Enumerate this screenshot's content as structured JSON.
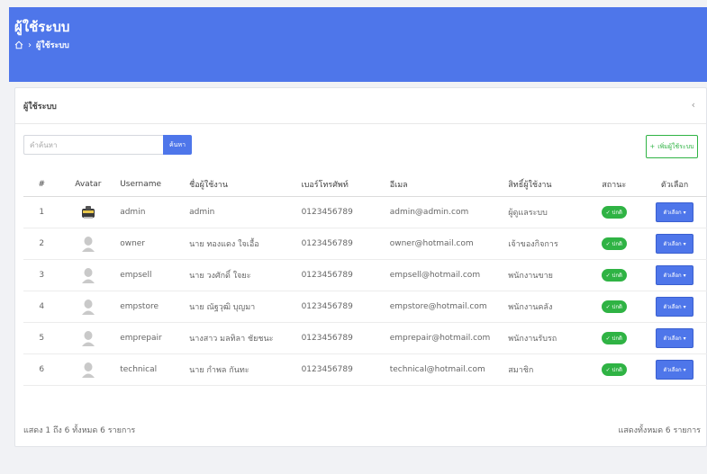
{
  "header": {
    "title": "ผู้ใช้ระบบ",
    "breadcrumb_current": "ผู้ใช้ระบบ",
    "breadcrumb_sep": "›"
  },
  "card": {
    "title": "ผู้ใช้ระบบ",
    "collapse_icon": "‹"
  },
  "search": {
    "placeholder": "คำค้นหา",
    "button_label": "ค้นหา"
  },
  "add_user": {
    "icon": "+",
    "label": "เพิ่มผู้ใช้ระบบ"
  },
  "table": {
    "headers": {
      "num": "#",
      "avatar": "Avatar",
      "username": "Username",
      "name": "ชื่อผู้ใช้งาน",
      "phone": "เบอร์โทรศัพท์",
      "email": "อีเมล",
      "role": "สิทธิ์ผู้ใช้งาน",
      "status": "สถานะ",
      "action": "ตัวเลือก"
    },
    "rows": [
      {
        "num": "1",
        "avatar": "robot-avatar",
        "username": "admin",
        "name": "admin",
        "phone": "0123456789",
        "email": "admin@admin.com",
        "role": "ผู้ดูแลระบบ",
        "status": "✓ ปกติ",
        "action": "ตัวเลือก ▾"
      },
      {
        "num": "2",
        "avatar": "user-avatar",
        "username": "owner",
        "name": "นาย ทองแดง ใจเอื้อ",
        "phone": "0123456789",
        "email": "owner@hotmail.com",
        "role": "เจ้าของกิจการ",
        "status": "✓ ปกติ",
        "action": "ตัวเลือก ▾"
      },
      {
        "num": "3",
        "avatar": "user-avatar",
        "username": "empsell",
        "name": "นาย วงศักดิ์ ใจยะ",
        "phone": "0123456789",
        "email": "empsell@hotmail.com",
        "role": "พนักงานขาย",
        "status": "✓ ปกติ",
        "action": "ตัวเลือก ▾"
      },
      {
        "num": "4",
        "avatar": "user-avatar",
        "username": "empstore",
        "name": "นาย ณัฐวุฒิ บุญมา",
        "phone": "0123456789",
        "email": "empstore@hotmail.com",
        "role": "พนักงานคลัง",
        "status": "✓ ปกติ",
        "action": "ตัวเลือก ▾"
      },
      {
        "num": "5",
        "avatar": "user-avatar",
        "username": "emprepair",
        "name": "นางสาว มลทิลา ชัยชนะ",
        "phone": "0123456789",
        "email": "emprepair@hotmail.com",
        "role": "พนักงานรับรถ",
        "status": "✓ ปกติ",
        "action": "ตัวเลือก ▾"
      },
      {
        "num": "6",
        "avatar": "user-avatar",
        "username": "technical",
        "name": "นาย กำพล กันทะ",
        "phone": "0123456789",
        "email": "technical@hotmail.com",
        "role": "สมาชิก",
        "status": "✓ ปกติ",
        "action": "ตัวเลือก ▾"
      }
    ]
  },
  "footer": {
    "left": "แสดง 1 ถึง 6 ทั้งหมด 6 รายการ",
    "right": "แสดงทั้งหมด 6 รายการ"
  },
  "colors": {
    "primary": "#4e76ea",
    "success": "#2fb344"
  }
}
